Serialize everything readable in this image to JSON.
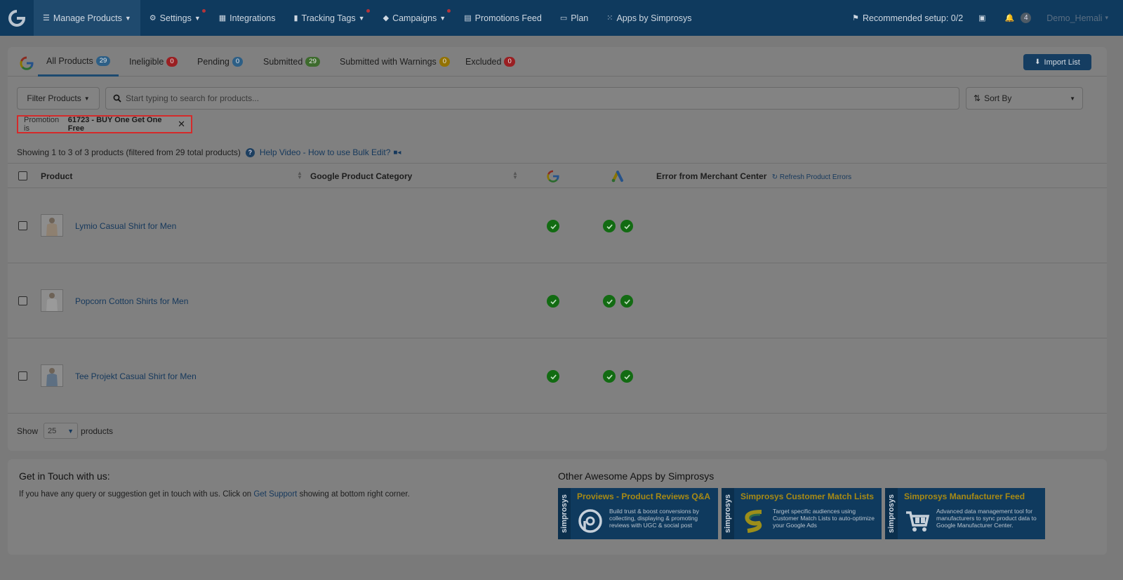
{
  "nav": {
    "items": [
      {
        "label": "Manage Products",
        "icon": "list-icon",
        "caret": true,
        "dot": false,
        "active": true
      },
      {
        "label": "Settings",
        "icon": "gear-icon",
        "caret": true,
        "dot": true,
        "active": false
      },
      {
        "label": "Integrations",
        "icon": "briefcase-icon",
        "caret": false,
        "dot": false,
        "active": false
      },
      {
        "label": "Tracking Tags",
        "icon": "bar-chart-icon",
        "caret": true,
        "dot": true,
        "active": false
      },
      {
        "label": "Campaigns",
        "icon": "tag-icon",
        "caret": true,
        "dot": true,
        "active": false
      },
      {
        "label": "Promotions Feed",
        "icon": "file-icon",
        "caret": false,
        "dot": false,
        "active": false
      },
      {
        "label": "Plan",
        "icon": "credit-card-icon",
        "caret": false,
        "dot": false,
        "active": false
      },
      {
        "label": "Apps by Simprosys",
        "icon": "grid-icon",
        "caret": false,
        "dot": false,
        "active": false
      }
    ],
    "recommended_setup": "Recommended setup: 0/2",
    "notification_count": "4",
    "username": "Demo_Hemali"
  },
  "tabs": [
    {
      "label": "All Products",
      "count": "29",
      "color": "blue",
      "active": true
    },
    {
      "label": "Ineligible",
      "count": "0",
      "color": "red",
      "active": false
    },
    {
      "label": "Pending",
      "count": "0",
      "color": "blue",
      "active": false
    },
    {
      "label": "Submitted",
      "count": "29",
      "color": "green",
      "active": false
    },
    {
      "label": "Submitted with Warnings",
      "count": "0",
      "color": "orange",
      "active": false
    },
    {
      "label": "Excluded",
      "count": "0",
      "color": "red",
      "active": false
    }
  ],
  "import_label": "Import List",
  "filter": {
    "button_label": "Filter Products",
    "search_placeholder": "Start typing to search for products...",
    "sort_label": "Sort By",
    "chip_prefix": "Promotion is",
    "chip_value": "61723 - BUY One Get One Free"
  },
  "summary": {
    "showing": "Showing 1 to 3 of 3 products (filtered from 29 total products)",
    "help_link": "Help Video - How to use Bulk Edit?"
  },
  "table": {
    "col_product": "Product",
    "col_category": "Google Product Category",
    "col_error": "Error from Merchant Center",
    "refresh_link": "Refresh Product Errors",
    "rows": [
      {
        "name": "Lymio Casual Shirt for Men",
        "category": "",
        "google_ok": true,
        "ads_ok": 2
      },
      {
        "name": "Popcorn Cotton Shirts for Men",
        "category": "",
        "google_ok": true,
        "ads_ok": 2
      },
      {
        "name": "Tee Projekt Casual Shirt for Men",
        "category": "",
        "google_ok": true,
        "ads_ok": 2
      }
    ],
    "show_label": "Show",
    "per_page": "25",
    "products_label": "products"
  },
  "footer": {
    "contact_title": "Get in Touch with us:",
    "contact_text_before": "If you have any query or suggestion get in touch with us. Click on",
    "contact_link": "Get Support",
    "contact_text_after": "showing at bottom right corner.",
    "apps_title": "Other Awesome Apps by Simprosys",
    "apps": [
      {
        "brand": "simprosys",
        "name": "Proviews - Product Reviews Q&A",
        "desc": "Build trust & boost conversions by collecting, displaying & promoting reviews with UGC & social post",
        "icon": "chat-bubble-icon"
      },
      {
        "brand": "simprosys",
        "name": "Simprosys Customer Match Lists",
        "desc": "Target specific audiences using Customer Match Lists to auto-optimize your Google Ads",
        "icon": "s-logo-icon"
      },
      {
        "brand": "simprosys",
        "name": "Simprosys Manufacturer Feed",
        "desc": "Advanced data management tool for manufacturers to sync product data to Google Manufacturer Center.",
        "icon": "cart-icon"
      }
    ]
  },
  "colors": {
    "nav_bg": "#0f3a5e",
    "accent": "#15385c",
    "chip_border": "#d42a2a",
    "check_green": "#126b12"
  }
}
